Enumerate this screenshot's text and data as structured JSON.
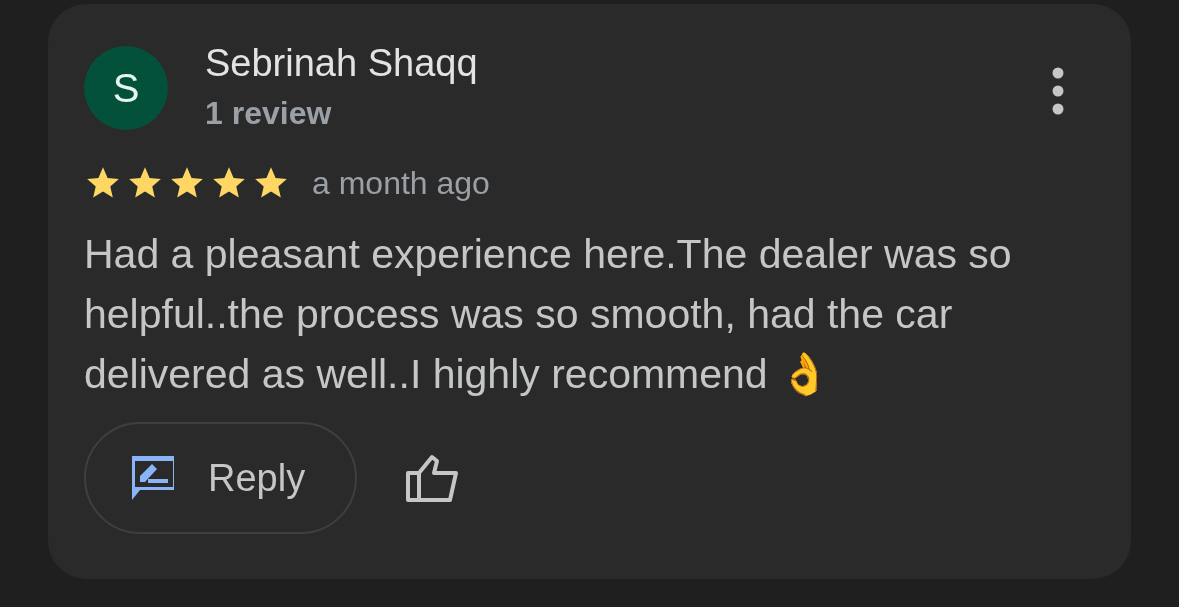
{
  "review": {
    "avatar_letter": "S",
    "author": "Sebrinah Shaqq",
    "review_count": "1 review",
    "stars": 5,
    "time": "a month ago",
    "text": "Had a pleasant experience here.The dealer was so helpful..the process was so smooth, had the car delivered as well..I highly recommend 👌",
    "reply_label": "Reply"
  }
}
